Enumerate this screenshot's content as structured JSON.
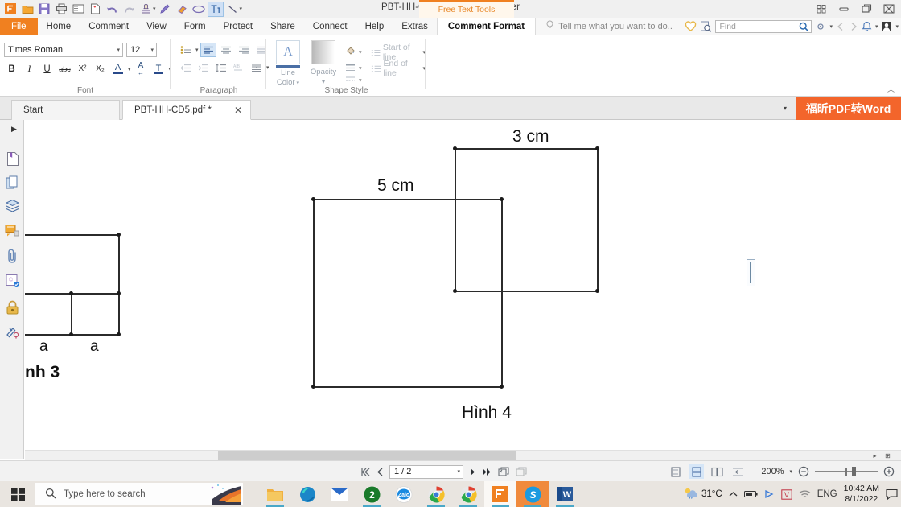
{
  "window": {
    "title": "PBT-HH-CĐ5.pdf * - Foxit Reader",
    "contextual_tab_group": "Free Text Tools"
  },
  "quick_access": {
    "items": [
      {
        "name": "foxit-logo-icon",
        "label": "Foxit"
      },
      {
        "name": "open-icon",
        "label": "Open"
      },
      {
        "name": "save-icon",
        "label": "Save"
      },
      {
        "name": "print-icon",
        "label": "Print"
      },
      {
        "name": "email-icon",
        "label": "Email"
      },
      {
        "name": "create-pdf-icon",
        "label": "Create PDF"
      },
      {
        "name": "undo-icon",
        "label": "Undo"
      },
      {
        "name": "redo-icon",
        "label": "Redo"
      },
      {
        "name": "stamp-icon",
        "label": "Stamp"
      },
      {
        "name": "pencil-icon",
        "label": "Pencil"
      },
      {
        "name": "eraser-icon",
        "label": "Eraser"
      },
      {
        "name": "ellipse-icon",
        "label": "Ellipse"
      },
      {
        "name": "typewriter-icon",
        "label": "Typewriter"
      },
      {
        "name": "line-icon",
        "label": "Line"
      }
    ]
  },
  "window_controls": [
    {
      "name": "layout-icon",
      "glyph": "▫"
    },
    {
      "name": "minimize-icon",
      "glyph": "—"
    },
    {
      "name": "restore-icon",
      "glyph": "❐"
    },
    {
      "name": "close-icon",
      "glyph": "✕"
    }
  ],
  "ribbon_tabs": [
    {
      "label": "File",
      "active": false,
      "file": true
    },
    {
      "label": "Home",
      "active": false
    },
    {
      "label": "Comment",
      "active": false
    },
    {
      "label": "View",
      "active": false
    },
    {
      "label": "Form",
      "active": false
    },
    {
      "label": "Protect",
      "active": false
    },
    {
      "label": "Share",
      "active": false
    },
    {
      "label": "Connect",
      "active": false
    },
    {
      "label": "Help",
      "active": false
    },
    {
      "label": "Extras",
      "active": false
    },
    {
      "label": "Comment Format",
      "active": true
    }
  ],
  "tell_me": {
    "placeholder": "Tell me what you want to do.."
  },
  "find": {
    "placeholder": "Find",
    "value": ""
  },
  "ribbon": {
    "font_group": {
      "label": "Font",
      "font_name": "Times Roman",
      "font_size": "12",
      "buttons": [
        {
          "name": "bold-button",
          "glyph": "B"
        },
        {
          "name": "italic-button",
          "glyph": "I"
        },
        {
          "name": "underline-button",
          "glyph": "U"
        },
        {
          "name": "strikethrough-button",
          "glyph": "abc"
        },
        {
          "name": "superscript-button",
          "glyph": "X²"
        },
        {
          "name": "subscript-button",
          "glyph": "X₂"
        },
        {
          "name": "font-color-button",
          "glyph": "A"
        },
        {
          "name": "character-spacing-button",
          "glyph": "A"
        },
        {
          "name": "text-style-button",
          "glyph": "T"
        }
      ]
    },
    "paragraph_group": {
      "label": "Paragraph",
      "row1": [
        {
          "name": "bullet-list-button"
        },
        {
          "name": "align-left-button",
          "active": true
        },
        {
          "name": "align-center-button"
        },
        {
          "name": "align-right-button"
        },
        {
          "name": "align-justify-button"
        }
      ],
      "row2": [
        {
          "name": "decrease-indent-button"
        },
        {
          "name": "increase-indent-button"
        },
        {
          "name": "line-spacing-button"
        },
        {
          "name": "text-direction-button"
        },
        {
          "name": "paragraph-spacing-button"
        }
      ]
    },
    "shape_style_group": {
      "label": "Shape Style",
      "line_color": "Line\nColor",
      "line_color_label_1": "Line",
      "line_color_label_2": "Color",
      "opacity_label": "Opacity",
      "start_of_line": "Start of line",
      "end_of_line": "End of line"
    }
  },
  "doc_tabs": {
    "tabs": [
      {
        "label": "Start",
        "active": false,
        "closable": false
      },
      {
        "label": "PBT-HH-CĐ5.pdf *",
        "active": true,
        "closable": true
      }
    ],
    "promo_banner": "福昕PDF转Word"
  },
  "left_panel": {
    "items": [
      {
        "name": "bookmarks-icon",
        "label": "Bookmarks"
      },
      {
        "name": "page-thumbnails-icon",
        "label": "Page Thumbnails"
      },
      {
        "name": "layers-icon",
        "label": "Layers"
      },
      {
        "name": "comments-icon",
        "label": "Comments"
      },
      {
        "name": "attachments-icon",
        "label": "Attachments"
      },
      {
        "name": "stamps-icon",
        "label": "Stamps"
      },
      {
        "name": "security-icon",
        "label": "Security"
      },
      {
        "name": "signatures-icon",
        "label": "Digital Signatures"
      }
    ]
  },
  "document": {
    "figure3": {
      "label_partial": "nh 3",
      "side_label_left": "a",
      "side_label_right": "a"
    },
    "figure4": {
      "caption": "Hình 4",
      "big_square_dim": "5 cm",
      "small_square_dim": "3 cm"
    }
  },
  "statusbar": {
    "page_value": "1 / 2",
    "zoom_level": "200%",
    "nav": [
      {
        "name": "first-page-button"
      },
      {
        "name": "previous-page-button"
      },
      {
        "name": "next-page-button"
      },
      {
        "name": "last-page-button"
      },
      {
        "name": "previous-view-button"
      },
      {
        "name": "next-view-button"
      }
    ],
    "view_modes": [
      {
        "name": "single-page-view-button",
        "active": false
      },
      {
        "name": "continuous-view-button",
        "active": true
      },
      {
        "name": "facing-view-button",
        "active": false
      },
      {
        "name": "split-view-button",
        "active": false
      }
    ]
  },
  "taskbar": {
    "search_placeholder": "Type here to search",
    "apps": [
      {
        "name": "file-explorer-icon",
        "label": "File Explorer",
        "running": true
      },
      {
        "name": "edge-icon",
        "label": "Microsoft Edge",
        "running": false
      },
      {
        "name": "mail-icon",
        "label": "Mail",
        "running": false
      },
      {
        "name": "unikey-icon",
        "label": "2",
        "running": true
      },
      {
        "name": "zalo-icon",
        "label": "Zalo",
        "running": true
      },
      {
        "name": "chrome-icon",
        "label": "Google Chrome",
        "running": true
      },
      {
        "name": "chrome-icon-2",
        "label": "Google Chrome",
        "running": true
      },
      {
        "name": "foxit-reader-icon",
        "label": "Foxit Reader",
        "running": true
      },
      {
        "name": "skype-icon",
        "label": "Skype",
        "running": true
      },
      {
        "name": "word-icon",
        "label": "Microsoft Word",
        "running": true
      }
    ],
    "tray": {
      "weather_temp": "31°C",
      "language": "ENG",
      "time": "10:42 AM",
      "date": "8/1/2022"
    }
  },
  "colors": {
    "accent_orange": "#f08020",
    "promo_orange": "#f3652b",
    "ribbon_bg": "#ffffff",
    "taskbar_bg": "#e9e5e0",
    "selection_blue": "#d6e6f7"
  }
}
